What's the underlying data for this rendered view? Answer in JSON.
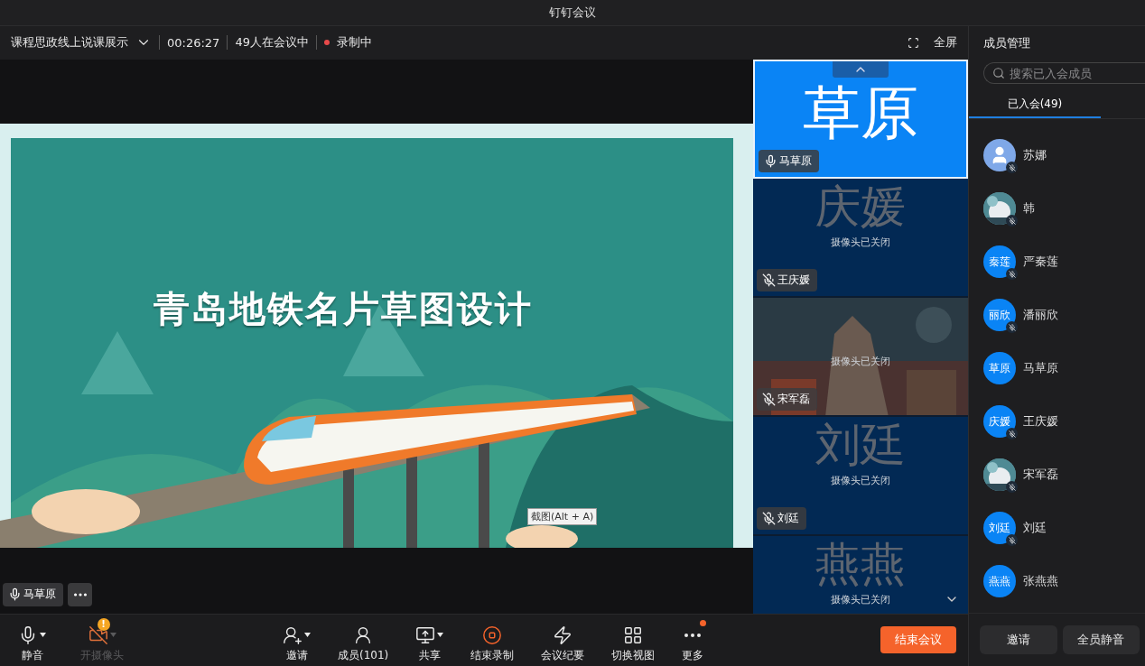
{
  "window": {
    "title": "钉钉会议"
  },
  "meeting_bar": {
    "title": "课程思政线上说课展示",
    "duration": "00:26:27",
    "attendance": "49人在会议中",
    "recording": {
      "label": "录制中",
      "on": true
    },
    "fullscreen": "全屏"
  },
  "slide": {
    "title": "青岛地铁名片草图设计"
  },
  "tooltip": "截图(Alt + A)",
  "speaker_tag": {
    "name": "马草原",
    "muted": false
  },
  "video_tiles": [
    {
      "kind": "avatar",
      "big_text": "草原",
      "name": "马草原",
      "muted": false,
      "speaking": true
    },
    {
      "kind": "avatar",
      "big_text": "庆媛",
      "status": "摄像头已关闭",
      "name": "王庆媛",
      "muted": true,
      "speaking": false
    },
    {
      "kind": "picture",
      "status": "摄像头已关闭",
      "name": "宋军磊",
      "muted": true,
      "speaking": false
    },
    {
      "kind": "avatar",
      "big_text": "刘廷",
      "status": "摄像头已关闭",
      "name": "刘廷",
      "muted": true,
      "speaking": false
    },
    {
      "kind": "avatar",
      "big_text": "燕燕",
      "status": "摄像头已关闭",
      "speaking": false
    }
  ],
  "toolbar": [
    {
      "kind": "mic",
      "label": "静音",
      "dropdown": true,
      "disabled": false
    },
    {
      "kind": "camera",
      "label": "开摄像头",
      "dropdown": true,
      "disabled": true,
      "alert": "!"
    },
    {
      "kind": "invite",
      "label": "邀请",
      "dropdown": true,
      "disabled": false
    },
    {
      "kind": "members",
      "label": "成员(101)",
      "dropdown": false,
      "disabled": false
    },
    {
      "kind": "share",
      "label": "共享",
      "dropdown": true,
      "disabled": false
    },
    {
      "kind": "record",
      "label": "结束录制",
      "dropdown": false,
      "disabled": false
    },
    {
      "kind": "notes",
      "label": "会议纪要",
      "dropdown": false,
      "disabled": false
    },
    {
      "kind": "grid",
      "label": "切换视图",
      "dropdown": false,
      "disabled": false
    },
    {
      "kind": "more",
      "label": "更多",
      "dropdown": false,
      "disabled": false,
      "notification": true
    }
  ],
  "end_button": "结束会议",
  "panel": {
    "title": "成员管理",
    "search": {
      "placeholder": "搜索已入会成员"
    },
    "tabs": [
      {
        "label": "已入会(49)",
        "selected": true
      }
    ],
    "members": [
      {
        "name": "苏娜",
        "kind": "silhouette",
        "muted": true
      },
      {
        "name": "韩",
        "kind": "picture",
        "muted": true
      },
      {
        "name": "严秦莲",
        "kind": "initials",
        "initials": "秦莲",
        "muted": true
      },
      {
        "name": "潘丽欣",
        "kind": "initials",
        "initials": "丽欣",
        "muted": true
      },
      {
        "name": "马草原",
        "kind": "initials",
        "initials": "草原",
        "muted": false
      },
      {
        "name": "王庆媛",
        "kind": "initials",
        "initials": "庆媛",
        "muted": true
      },
      {
        "name": "宋军磊",
        "kind": "picture",
        "muted": true
      },
      {
        "name": "刘廷",
        "kind": "initials",
        "initials": "刘廷",
        "muted": true
      },
      {
        "name": "张燕燕",
        "kind": "initials",
        "initials": "燕燕",
        "muted": false
      }
    ],
    "buttons": [
      "邀请",
      "全员静音"
    ]
  }
}
